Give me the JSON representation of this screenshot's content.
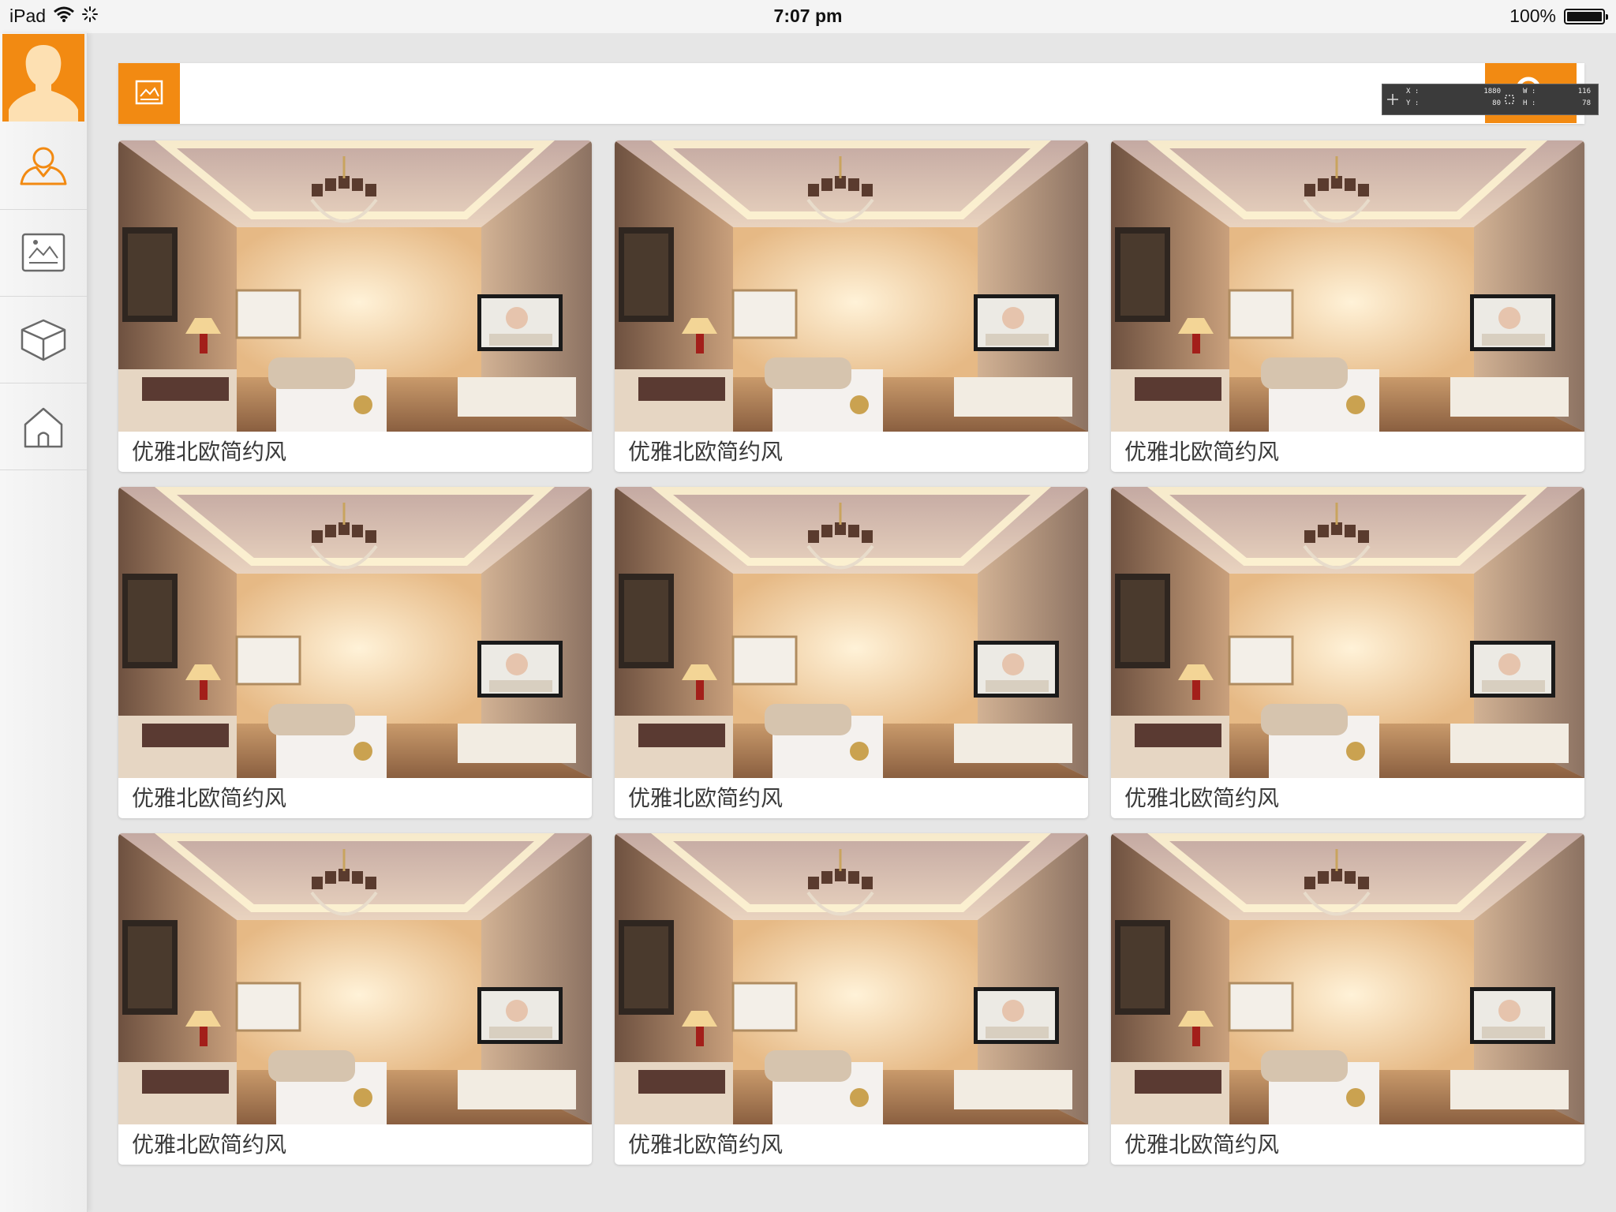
{
  "status_bar": {
    "device": "iPad",
    "time": "7:07 pm",
    "battery": "100%",
    "battery_level": 1.0
  },
  "sidebar": {
    "avatar_icon": "user-avatar-icon",
    "items": [
      {
        "name": "user-icon",
        "active": true
      },
      {
        "name": "image-icon",
        "active": false
      },
      {
        "name": "box-icon",
        "active": false
      },
      {
        "name": "house-icon",
        "active": false
      }
    ]
  },
  "search": {
    "left_icon": "image-icon",
    "button_icon": "search-icon",
    "value": "",
    "overlay": {
      "x_label": "X :",
      "x_value": "1880",
      "y_label": "Y :",
      "y_value": "80",
      "w_label": "W :",
      "w_value": "116",
      "h_label": "H :",
      "h_value": "78"
    }
  },
  "grid": {
    "cards": [
      {
        "caption": "优雅北欧简约风"
      },
      {
        "caption": "优雅北欧简约风"
      },
      {
        "caption": "优雅北欧简约风"
      },
      {
        "caption": "优雅北欧简约风"
      },
      {
        "caption": "优雅北欧简约风"
      },
      {
        "caption": "优雅北欧简约风"
      },
      {
        "caption": "优雅北欧简约风"
      },
      {
        "caption": "优雅北欧简约风"
      },
      {
        "caption": "优雅北欧简约风"
      }
    ]
  },
  "colors": {
    "accent": "#f28a12",
    "background": "#e6e6e6",
    "card": "#ffffff",
    "text": "#3a3a3a"
  }
}
